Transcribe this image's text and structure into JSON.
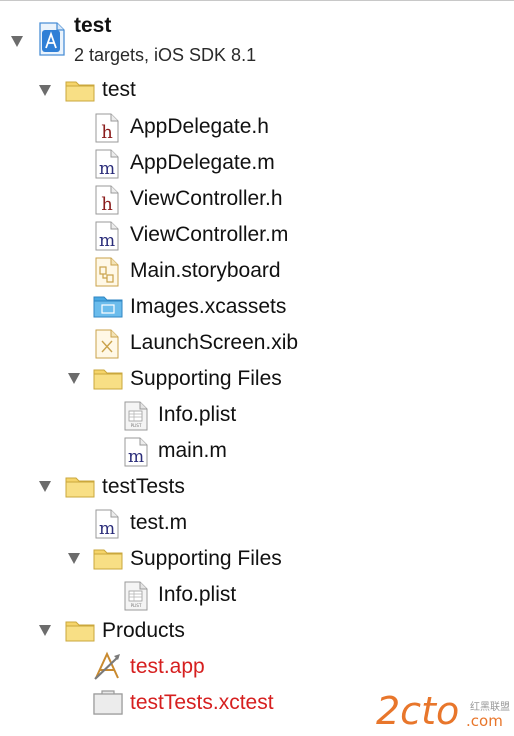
{
  "project": {
    "name": "test",
    "subtitle": "2 targets, iOS SDK 8.1"
  },
  "tree": [
    {
      "label": "test",
      "kind": "folder",
      "level": 1,
      "expanded": true
    },
    {
      "label": "AppDelegate.h",
      "kind": "h",
      "level": 2
    },
    {
      "label": "AppDelegate.m",
      "kind": "m",
      "level": 2
    },
    {
      "label": "ViewController.h",
      "kind": "h",
      "level": 2
    },
    {
      "label": "ViewController.m",
      "kind": "m",
      "level": 2
    },
    {
      "label": "Main.storyboard",
      "kind": "storyboard",
      "level": 2
    },
    {
      "label": "Images.xcassets",
      "kind": "xcassets",
      "level": 2
    },
    {
      "label": "LaunchScreen.xib",
      "kind": "xib",
      "level": 2
    },
    {
      "label": "Supporting Files",
      "kind": "folder",
      "level": 2,
      "expanded": true
    },
    {
      "label": "Info.plist",
      "kind": "plist",
      "level": 3
    },
    {
      "label": "main.m",
      "kind": "m",
      "level": 3
    },
    {
      "label": "testTests",
      "kind": "folder",
      "level": 1,
      "expanded": true
    },
    {
      "label": "test.m",
      "kind": "m",
      "level": 2
    },
    {
      "label": "Supporting Files",
      "kind": "folder",
      "level": 2,
      "expanded": true
    },
    {
      "label": "Info.plist",
      "kind": "plist",
      "level": 3
    },
    {
      "label": "Products",
      "kind": "folder",
      "level": 1,
      "expanded": true
    },
    {
      "label": "test.app",
      "kind": "app",
      "level": 2,
      "missing": true
    },
    {
      "label": "testTests.xctest",
      "kind": "xctest",
      "level": 2,
      "missing": true
    }
  ],
  "watermark": {
    "logo": "2cto",
    "suffix": ".com",
    "cn": "红黑联盟"
  },
  "colors": {
    "missing_file": "#d61f1f",
    "folder": "#f5d46a",
    "header_letter": "#8b1c1c",
    "impl_letter": "#2b2d7a",
    "assets": "#4aa9e3"
  }
}
